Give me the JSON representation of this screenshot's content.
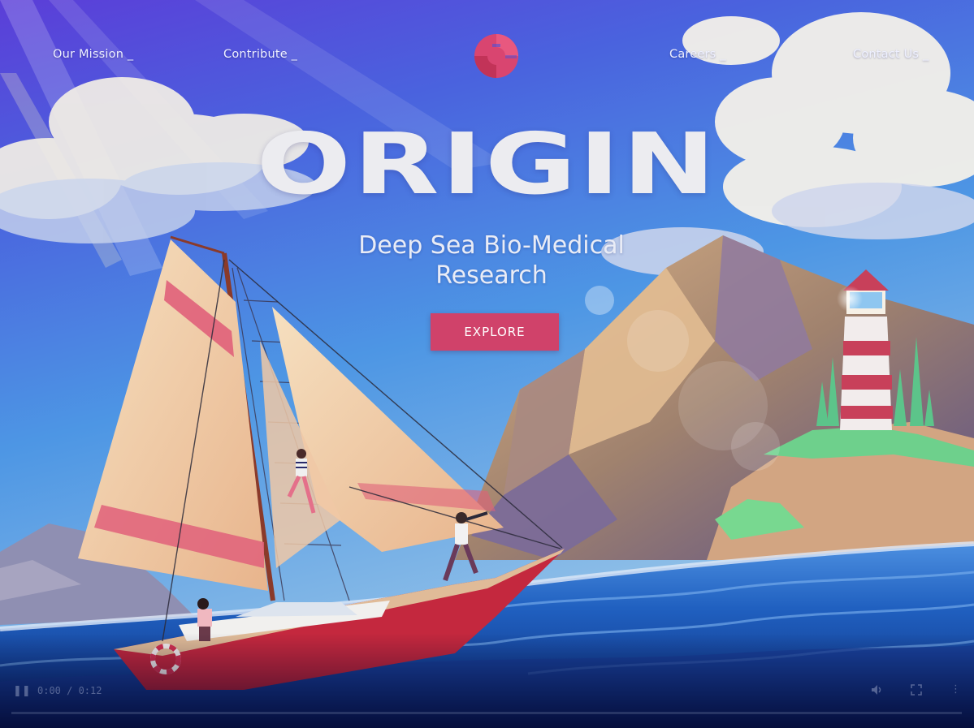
{
  "nav": {
    "items": [
      {
        "label": "Our Mission _"
      },
      {
        "label": "Contribute _"
      },
      {
        "label": "Careers _"
      },
      {
        "label": "Contact Us _"
      }
    ]
  },
  "hero": {
    "title": "ORIGIN",
    "subtitle_line1": "Deep Sea Bio-Medical",
    "subtitle_line2": "Research",
    "cta_label": "EXPLORE"
  },
  "video": {
    "time": "0:00 / 0:12",
    "progress": 0
  },
  "colors": {
    "accent": "#d0426a",
    "sky_top": "#5a3fd6",
    "sky_mid": "#4c8fe6",
    "sea": "#1c4fb0",
    "boat_hull": "#c4283e",
    "sail": "#f2cfa6"
  },
  "icons": {
    "logo": "origin-logo-icon",
    "play": "play-pause-icon",
    "volume": "volume-icon",
    "fullscreen": "fullscreen-icon",
    "more": "more-vertical-icon"
  }
}
